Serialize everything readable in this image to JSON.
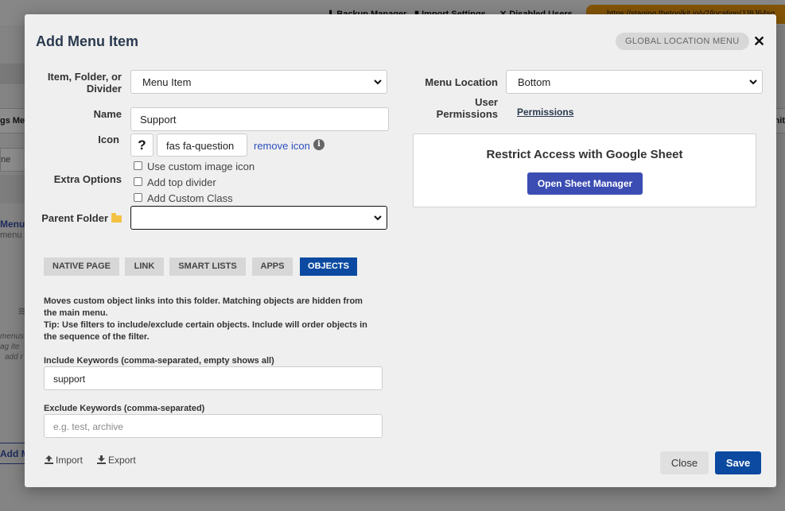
{
  "background": {
    "top_links": [
      "Backup Manager",
      "Import Settings",
      "Disabled Users"
    ],
    "url_text": "https://staging.thetoolkit.io/v2/location/JJ8J64sq",
    "left_header": "gs Me",
    "right_header": "nit",
    "search_fragment": "ne",
    "menu_title": "Menu",
    "menu_sub": "menu",
    "italic_lines": [
      "menus",
      "ag ite",
      "add r"
    ],
    "add_button": "Add M"
  },
  "modal": {
    "title": "Add Menu Item",
    "badge": "GLOBAL LOCATION MENU",
    "close_glyph": "✕",
    "left": {
      "type_label": "Item, Folder, or Divider",
      "type_value": "Menu Item",
      "name_label": "Name",
      "name_value": "Support",
      "icon_label": "Icon",
      "icon_glyph": "?",
      "icon_class": "fas fa-question",
      "remove_icon": "remove icon",
      "info_glyph": "i",
      "extra_label": "Extra Options",
      "options": [
        "Use custom image icon",
        "Add top divider",
        "Add Custom Class"
      ],
      "parent_label": "Parent Folder",
      "parent_value": ""
    },
    "tabs": [
      {
        "label": "NATIVE PAGE",
        "active": false
      },
      {
        "label": "LINK",
        "active": false
      },
      {
        "label": "SMART LISTS",
        "active": false
      },
      {
        "label": "APPS",
        "active": false
      },
      {
        "label": "OBJECTS",
        "active": true
      }
    ],
    "objects": {
      "description": "Moves custom object links into this folder. Matching objects are hidden from the main menu.",
      "tip": "Tip: Use filters to include/exclude certain objects. Include will order objects in the sequence of the filter.",
      "include_label": "Include Keywords (comma-separated, empty shows all)",
      "include_value": "support",
      "exclude_label": "Exclude Keywords (comma-separated)",
      "exclude_placeholder": "e.g. test, archive"
    },
    "right": {
      "location_label": "Menu Location",
      "location_value": "Bottom",
      "permissions_label": "User Permissions",
      "permissions_link": "Permissions",
      "sheet_title": "Restrict Access with Google Sheet",
      "sheet_button": "Open Sheet Manager"
    },
    "footer": {
      "import": "Import",
      "export": "Export",
      "close": "Close",
      "save": "Save"
    }
  },
  "colors": {
    "primary": "#0b4aa0",
    "sheet_button": "#3b4db2",
    "link": "#2c4fbf",
    "url_bar": "#f29b0c"
  }
}
